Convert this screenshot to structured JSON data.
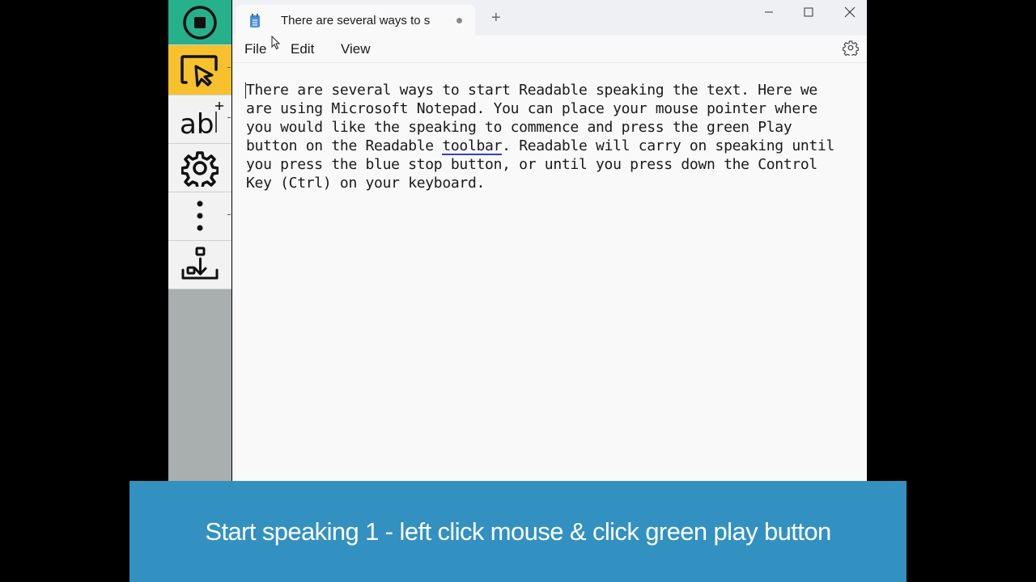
{
  "toolbar": {
    "buttons": [
      {
        "name": "stop",
        "icon": "stop-icon",
        "color": "#27b08c"
      },
      {
        "name": "play-pointer",
        "icon": "pointer-play-icon",
        "color": "#f6c12c"
      },
      {
        "name": "ab-text",
        "icon": "ab-text-icon",
        "label": "ab"
      },
      {
        "name": "settings",
        "icon": "gear-icon"
      },
      {
        "name": "more",
        "icon": "more-vertical-icon"
      },
      {
        "name": "dock",
        "icon": "dock-icon"
      }
    ]
  },
  "notepad": {
    "tab_title": "There are several ways to s",
    "new_tab_glyph": "+",
    "menu": {
      "file": "File",
      "edit": "Edit",
      "view": "View"
    },
    "text_lines": [
      "There are several ways to start Readable speaking the text. Here we",
      "are using Microsoft Notepad. You can place your mouse pointer where",
      "you would like the speaking to commence and press the green Play",
      "button on the Readable ",
      "toolbar",
      ". Readable will carry on speaking until",
      "you press the blue stop button, or until you press down the Control",
      "Key (Ctrl) on your keyboard."
    ]
  },
  "caption": {
    "text": "Start speaking 1 - left click mouse & click green play button",
    "background": "#3291c0"
  }
}
